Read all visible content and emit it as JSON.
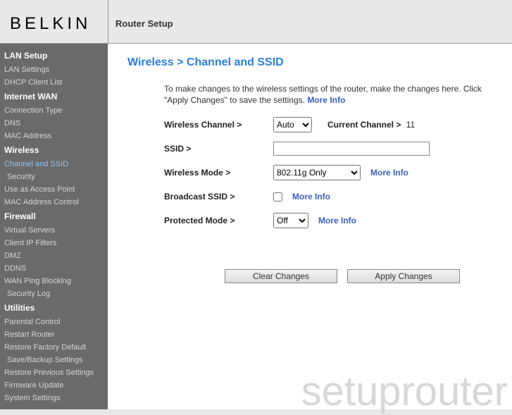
{
  "logo": "BELKIN",
  "header_title": "Router Setup",
  "page_title": "Wireless > Channel and SSID",
  "instructions": {
    "line": "To make changes to the wireless settings of the router, make the changes here. Click \"Apply Changes\" to save the settings.",
    "more": "More Info"
  },
  "fields": {
    "channel_label": "Wireless Channel >",
    "channel_value": "Auto",
    "current_channel_label": "Current Channel >",
    "current_channel_value": "11",
    "ssid_label": "SSID >",
    "ssid_value": "",
    "mode_label": "Wireless Mode >",
    "mode_value": "802.11g Only",
    "mode_more": "More Info",
    "broadcast_label": "Broadcast SSID >",
    "broadcast_checked": false,
    "broadcast_more": "More Info",
    "protected_label": "Protected Mode >",
    "protected_value": "Off",
    "protected_more": "More Info"
  },
  "buttons": {
    "clear": "Clear Changes",
    "apply": "Apply Changes"
  },
  "sidebar": [
    {
      "type": "h",
      "label": "LAN Setup"
    },
    {
      "type": "i",
      "label": "LAN Settings"
    },
    {
      "type": "i",
      "label": "DHCP Client List"
    },
    {
      "type": "h",
      "label": "Internet WAN"
    },
    {
      "type": "i",
      "label": "Connection Type"
    },
    {
      "type": "i",
      "label": "DNS"
    },
    {
      "type": "i",
      "label": "MAC Address"
    },
    {
      "type": "h",
      "label": "Wireless"
    },
    {
      "type": "a",
      "label": "Channel and SSID"
    },
    {
      "type": "i",
      "label": "Security",
      "indent": true
    },
    {
      "type": "i",
      "label": "Use as Access Point"
    },
    {
      "type": "i",
      "label": "MAC Address Control"
    },
    {
      "type": "h",
      "label": "Firewall"
    },
    {
      "type": "i",
      "label": "Virtual Servers"
    },
    {
      "type": "i",
      "label": "Client IP Filters"
    },
    {
      "type": "i",
      "label": "DMZ"
    },
    {
      "type": "i",
      "label": "DDNS"
    },
    {
      "type": "i",
      "label": "WAN Ping Blocking"
    },
    {
      "type": "i",
      "label": "Security Log",
      "indent": true
    },
    {
      "type": "h",
      "label": "Utilities"
    },
    {
      "type": "i",
      "label": "Parental Control"
    },
    {
      "type": "i",
      "label": "Restart Router"
    },
    {
      "type": "i",
      "label": "Restore Factory Default"
    },
    {
      "type": "i",
      "label": "Save/Backup Settings",
      "indent": true
    },
    {
      "type": "i",
      "label": "Restore Previous Settings"
    },
    {
      "type": "i",
      "label": "Firmware Update"
    },
    {
      "type": "i",
      "label": "System Settings"
    }
  ],
  "watermark": "setuprouter"
}
